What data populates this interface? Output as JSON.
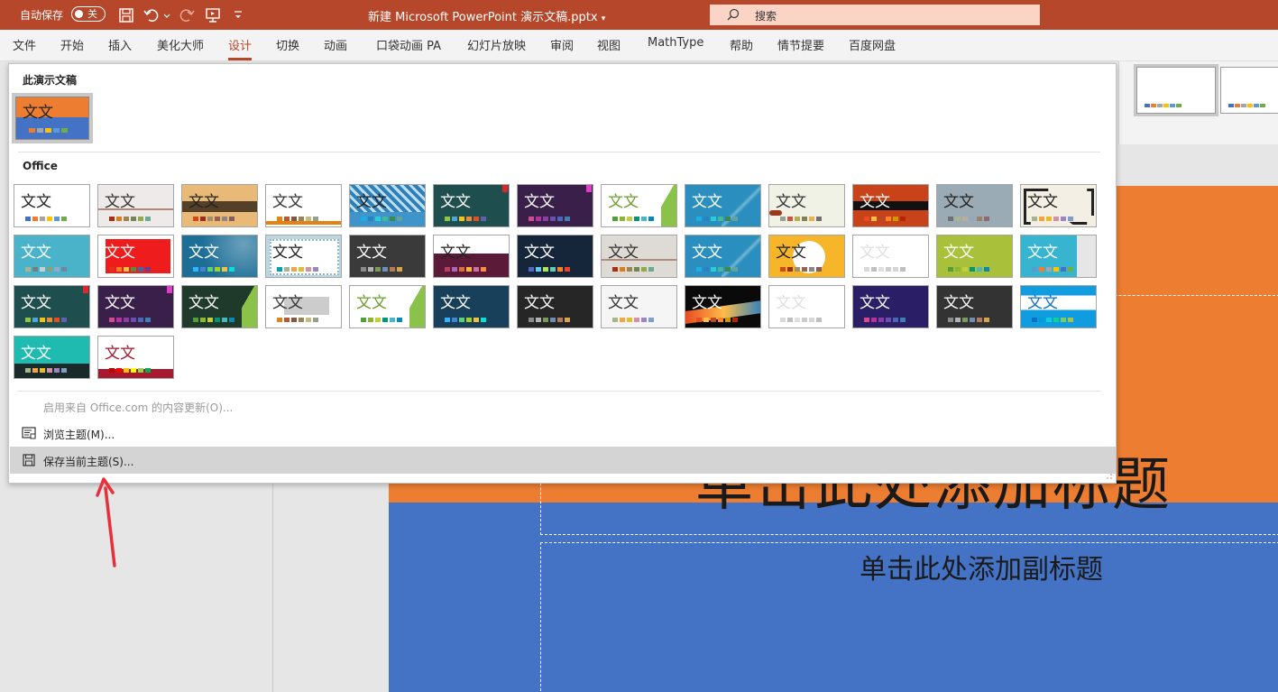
{
  "titlebar": {
    "autosave_label": "自动保存",
    "autosave_state": "关",
    "doc_title": "新建 Microsoft PowerPoint 演示文稿.pptx",
    "search_label": "搜索",
    "color": "#b7472a"
  },
  "tabs": [
    "文件",
    "开始",
    "插入",
    "美化大师",
    "设计",
    "切换",
    "动画",
    "口袋动画 PA",
    "幻灯片放映",
    "审阅",
    "视图",
    "MathType",
    "帮助",
    "情节提要",
    "百度网盘"
  ],
  "active_tab": "设计",
  "gallery": {
    "current_section_title": "此演示文稿",
    "office_section_title": "Office",
    "theme_sample_text": "文文",
    "themes": [
      {
        "bg": "#ffffff",
        "fg": "#222222",
        "deco": "none",
        "bars": [
          "#4472c4",
          "#ed7d31",
          "#a5a5a5",
          "#ffc000",
          "#5b9bd5",
          "#70ad47"
        ]
      },
      {
        "bg": "#eeeaea",
        "fg": "#333333",
        "deco": "lines",
        "bars": [
          "#a53010",
          "#de7e18",
          "#9f8351",
          "#728653",
          "#92aa4c",
          "#6aac91"
        ]
      },
      {
        "bg": "#e9b977",
        "fg": "#222222",
        "deco": "band-dark",
        "bars": [
          "#d34817",
          "#9b2d1f",
          "#a28e6a",
          "#956251",
          "#918485",
          "#855d5d"
        ]
      },
      {
        "bg": "#ffffff",
        "fg": "#333333",
        "deco": "bottomline",
        "bars": [
          "#e48312",
          "#bd582c",
          "#865640",
          "#9b8357",
          "#c2bc80",
          "#94a088"
        ]
      },
      {
        "bg": "#3f94c9",
        "fg": "#222222",
        "deco": "pattern",
        "bars": [
          "#1cade4",
          "#2683c6",
          "#27ced7",
          "#42ba97",
          "#3e8853",
          "#62a39f"
        ]
      },
      {
        "bg": "#1f4e4e",
        "fg": "#ffffff",
        "deco": "corner-red",
        "bars": [
          "#8dc73f",
          "#4ea5d6",
          "#f2c314",
          "#f0883a",
          "#e84c22",
          "#5e62ac"
        ]
      },
      {
        "bg": "#3a1f4a",
        "fg": "#ffffff",
        "deco": "corner-pink",
        "bars": [
          "#d34a90",
          "#b9309d",
          "#8b3ca6",
          "#6b4fb0",
          "#4b68b6",
          "#3d80b2"
        ]
      },
      {
        "bg": "#ffffff",
        "fg": "#6c9e2e",
        "deco": "green-right",
        "bars": [
          "#549e39",
          "#8ab833",
          "#c0cf3a",
          "#029676",
          "#4ab5c4",
          "#0989b1"
        ]
      },
      {
        "bg": "#2a8fbe",
        "fg": "#ffffff",
        "deco": "diag",
        "bars": [
          "#1cade4",
          "#2683c6",
          "#27ced7",
          "#42ba97",
          "#3e8853",
          "#62a39f"
        ]
      },
      {
        "bg": "#f1f2e6",
        "fg": "#333333",
        "deco": "brush",
        "bars": [
          "#93a299",
          "#cf543f",
          "#b5ae53",
          "#848058",
          "#e8b54d",
          "#786c71"
        ]
      },
      {
        "bg": "#c8421a",
        "fg": "#ffffff",
        "deco": "band-black",
        "bars": [
          "#e84c22",
          "#ffbd47",
          "#b64926",
          "#ff8427",
          "#cc9900",
          "#b22600"
        ]
      },
      {
        "bg": "#9aabb5",
        "fg": "#222222",
        "deco": "none",
        "bars": [
          "#6f6f74",
          "#a7b789",
          "#beae98",
          "#92a9b9",
          "#9c8265",
          "#8d6974"
        ]
      },
      {
        "bg": "#f3efe4",
        "fg": "#222222",
        "deco": "frame",
        "bars": [
          "#a5b592",
          "#f3a447",
          "#e7bc29",
          "#d092a7",
          "#9c85c0",
          "#809ec2"
        ]
      },
      {
        "bg": "#4bb3c9",
        "fg": "#ffffff",
        "deco": "none",
        "bars": [
          "#a5b592",
          "#6f8183",
          "#c1d2d6",
          "#8b9e7d",
          "#96a8c7",
          "#6b8b9d"
        ]
      },
      {
        "bg": "#ffffff",
        "fg": "#ffffff",
        "deco": "red-block",
        "bars": [
          "#e32d1e",
          "#f47f24",
          "#fbc440",
          "#5a8a3d",
          "#3b6ba5",
          "#6e3b90"
        ]
      },
      {
        "bg": "#1c6e97",
        "fg": "#ffffff",
        "deco": "glow",
        "bars": [
          "#31b6fd",
          "#4584d3",
          "#5bd078",
          "#a5d028",
          "#f5c040",
          "#05e0db"
        ]
      },
      {
        "bg": "#bcd6e0",
        "fg": "#222222",
        "deco": "dots",
        "bars": [
          "#00a0b8",
          "#a5b592",
          "#f3a447",
          "#e7bc29",
          "#d092a7",
          "#9c85c0"
        ]
      },
      {
        "bg": "#3a3a3a",
        "fg": "#ffffff",
        "deco": "none",
        "bars": [
          "#8b8b8b",
          "#b3b3b3",
          "#7a9a5a",
          "#6b8fb5",
          "#b57a5a",
          "#d4a84a"
        ]
      },
      {
        "bg": "#ffffff",
        "fg": "#222222",
        "deco": "maroon",
        "bars": [
          "#b83d68",
          "#ac66bb",
          "#de6c36",
          "#f9b639",
          "#cf6da4",
          "#fa8d3d"
        ]
      },
      {
        "bg": "#16263a",
        "fg": "#ffffff",
        "deco": "none",
        "bars": [
          "#4e67c8",
          "#5eccf3",
          "#a7ea52",
          "#5dceaf",
          "#ff8021",
          "#f14124"
        ]
      },
      {
        "bg": "#dedbd6",
        "fg": "#333333",
        "deco": "lines",
        "bars": [
          "#a53010",
          "#de7e18",
          "#9f8351",
          "#728653",
          "#92aa4c",
          "#6aac91"
        ]
      },
      {
        "bg": "#2a8fbe",
        "fg": "#ffffff",
        "deco": "diag",
        "bars": [
          "#1cade4",
          "#2683c6",
          "#27ced7",
          "#42ba97",
          "#3e8853",
          "#62a39f"
        ]
      },
      {
        "bg": "#f7b52a",
        "fg": "#222222",
        "deco": "circle",
        "bars": [
          "#d34817",
          "#9b2d1f",
          "#a28e6a",
          "#956251",
          "#918485",
          "#855d5d"
        ]
      },
      {
        "bg": "#ffffff",
        "fg": "#e0e0e0",
        "deco": "none",
        "bars": [
          "#d9d9d9",
          "#c0c0c0",
          "#e0e0e0",
          "#cccccc",
          "#d6d6d6",
          "#bfbfbf"
        ]
      },
      {
        "bg": "#a9c13a",
        "fg": "#ffffff",
        "deco": "none",
        "bars": [
          "#549e39",
          "#8ab833",
          "#c0cf3a",
          "#029676",
          "#4ab5c4",
          "#0989b1"
        ]
      },
      {
        "bg": "#37b4d0",
        "fg": "#ffffff",
        "deco": "grey-right",
        "bars": [
          "#5b9bd5",
          "#ed7d31",
          "#a5a5a5",
          "#ffc000",
          "#4472c4",
          "#70ad47"
        ]
      },
      {
        "bg": "#1f4e4e",
        "fg": "#ffffff",
        "deco": "corner-red",
        "bars": [
          "#8dc73f",
          "#4ea5d6",
          "#f2c314",
          "#f0883a",
          "#e84c22",
          "#5e62ac"
        ]
      },
      {
        "bg": "#3a1f4a",
        "fg": "#ffffff",
        "deco": "corner-pink",
        "bars": [
          "#d34a90",
          "#b9309d",
          "#8b3ca6",
          "#6b4fb0",
          "#4b68b6",
          "#3d80b2"
        ]
      },
      {
        "bg": "#1f3a2a",
        "fg": "#ffffff",
        "deco": "green-right",
        "bars": [
          "#549e39",
          "#8ab833",
          "#c0cf3a",
          "#029676",
          "#4ab5c4",
          "#0989b1"
        ]
      },
      {
        "bg": "#ffffff",
        "fg": "#333333",
        "deco": "grey-rect",
        "bars": [
          "#e48312",
          "#bd582c",
          "#865640",
          "#9b8357",
          "#c2bc80",
          "#94a088"
        ]
      },
      {
        "bg": "#ffffff",
        "fg": "#6c9e2e",
        "deco": "green-right",
        "bars": [
          "#549e39",
          "#8ab833",
          "#c0cf3a",
          "#029676",
          "#4ab5c4",
          "#0989b1"
        ]
      },
      {
        "bg": "#19405a",
        "fg": "#ffffff",
        "deco": "none",
        "bars": [
          "#31b6fd",
          "#4584d3",
          "#5bd078",
          "#a5d028",
          "#f5c040",
          "#05e0db"
        ]
      },
      {
        "bg": "#262626",
        "fg": "#ffffff",
        "deco": "none",
        "bars": [
          "#8b8b8b",
          "#b3b3b3",
          "#7a9a5a",
          "#6b8fb5",
          "#b57a5a",
          "#d4a84a"
        ]
      },
      {
        "bg": "#f5f5f5",
        "fg": "#333333",
        "deco": "none",
        "bars": [
          "#a5b592",
          "#f3a447",
          "#e7bc29",
          "#d092a7",
          "#9c85c0",
          "#809ec2"
        ]
      },
      {
        "bg": "#0a0a0a",
        "fg": "#ffffff",
        "deco": "swoosh",
        "bars": [
          "#e84c22",
          "#ffbd47",
          "#b64926",
          "#ff8427",
          "#cc9900",
          "#b22600"
        ]
      },
      {
        "bg": "#ffffff",
        "fg": "#e0e0e0",
        "deco": "none",
        "bars": [
          "#d9d9d9",
          "#c0c0c0",
          "#e0e0e0",
          "#cccccc",
          "#d6d6d6",
          "#bfbfbf"
        ]
      },
      {
        "bg": "#2a1e66",
        "fg": "#ffffff",
        "deco": "none",
        "bars": [
          "#d34a90",
          "#b9309d",
          "#8b3ca6",
          "#6b4fb0",
          "#4b68b6",
          "#3d80b2"
        ]
      },
      {
        "bg": "#333333",
        "fg": "#ffffff",
        "deco": "none",
        "bars": [
          "#8b8b8b",
          "#b3b3b3",
          "#7a9a5a",
          "#6b8fb5",
          "#b57a5a",
          "#d4a84a"
        ]
      },
      {
        "bg": "#ffffff",
        "fg": "#0f6fc6",
        "deco": "blue-bands",
        "bars": [
          "#0f6fc6",
          "#009dd9",
          "#0bd0d9",
          "#10cf9b",
          "#7cca62",
          "#a5c249"
        ]
      },
      {
        "bg": "#1fbab0",
        "fg": "#ffffff",
        "deco": "dark-bottom",
        "bars": [
          "#a5b592",
          "#f3a447",
          "#e7bc29",
          "#d092a7",
          "#9c85c0",
          "#809ec2"
        ]
      },
      {
        "bg": "#ffffff",
        "fg": "#a6192e",
        "deco": "red-bottom",
        "bars": [
          "#c00000",
          "#ff0000",
          "#ffc000",
          "#ffff00",
          "#92d050",
          "#00b050"
        ]
      }
    ],
    "current_theme": {
      "top": "#ed7d31",
      "bottom": "#4472c4",
      "fg": "#ffffff",
      "bars": [
        "#ed7d31",
        "#a5a5a5",
        "#ffc000",
        "#5b9bd5",
        "#70ad47"
      ]
    },
    "menu": {
      "update_label": "启用来自 Office.com 的内容更新(O)...",
      "browse_label": "浏览主题(M)...",
      "save_label": "保存当前主题(S)..."
    }
  },
  "ribbon_right": {
    "thumb1_bars": [
      "#4472c4",
      "#ed7d31",
      "#a5a5a5",
      "#ffc000",
      "#5b9bd5",
      "#70ad47"
    ],
    "thumb2_bars": [
      "#4472c4",
      "#ed7d31",
      "#a5a5a5",
      "#ffc000",
      "#5b9bd5",
      "#70ad47"
    ]
  },
  "slide": {
    "title": "单击此处添加标题",
    "subtitle": "单击此处添加副标题",
    "top_color": "#ed7d31",
    "bottom_color": "#4472c4"
  },
  "annotation": {
    "arrow_color": "#e8303a"
  }
}
